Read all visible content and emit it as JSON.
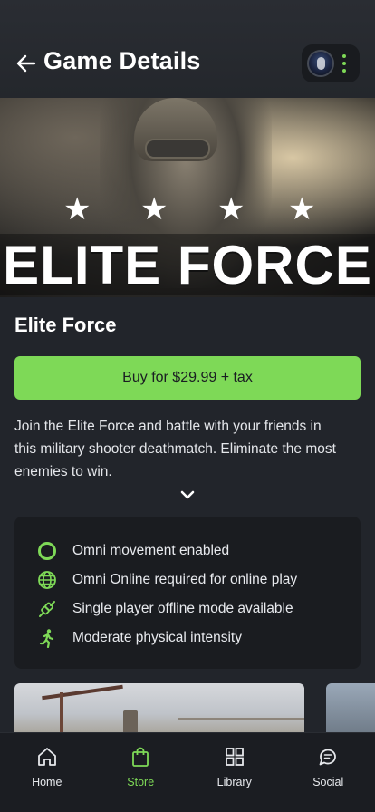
{
  "header": {
    "title": "Game Details",
    "back_icon": "arrow-left-icon",
    "menu_icon": "more-vertical-icon",
    "accent": "#7ed957"
  },
  "hero": {
    "banner_text": "ELITE FORCE",
    "stars": [
      "★",
      "★",
      "★",
      "★"
    ]
  },
  "game": {
    "title": "Elite Force",
    "buy_label": "Buy for $29.99 + tax",
    "description": "Join the Elite Force and battle with your friends in this military shooter deathmatch. Eliminate the most enemies to win.",
    "expand_icon": "chevron-down-icon"
  },
  "features": [
    {
      "icon": "ring-icon",
      "label": "Omni movement enabled"
    },
    {
      "icon": "globe-icon",
      "label": "Omni Online required for online play"
    },
    {
      "icon": "offline-plug-icon",
      "label": "Single player offline mode available"
    },
    {
      "icon": "running-icon",
      "label": "Moderate physical intensity"
    }
  ],
  "tabs": [
    {
      "label": "Home",
      "icon": "home-icon",
      "active": false
    },
    {
      "label": "Store",
      "icon": "shopping-bag-icon",
      "active": true
    },
    {
      "label": "Library",
      "icon": "grid-icon",
      "active": false
    },
    {
      "label": "Social",
      "icon": "chat-bubble-icon",
      "active": false
    }
  ]
}
